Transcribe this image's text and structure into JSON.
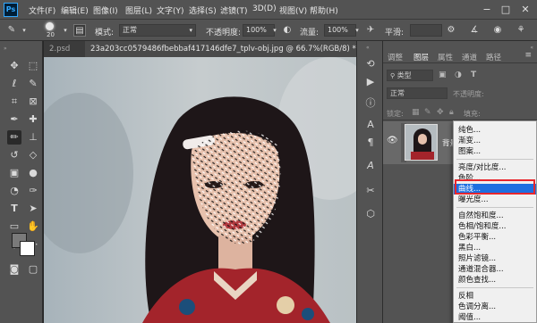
{
  "app": {
    "logo": "Ps"
  },
  "menubar": {
    "items": [
      "文件(F)",
      "编辑(E)",
      "图像(I)",
      "图层(L)",
      "文字(Y)",
      "选择(S)",
      "滤镜(T)",
      "3D(D)",
      "视图(V)",
      "帮助(H)"
    ],
    "window_controls": {
      "minimize": "−",
      "maximize": "□",
      "close": "✕"
    }
  },
  "options_bar": {
    "brush_size": "20",
    "mode_label": "模式:",
    "mode_value": "正常",
    "opacity_label": "不透明度:",
    "opacity_value": "100%",
    "flow_label": "流量:",
    "flow_value": "100%",
    "smooth_label": "平滑:"
  },
  "document_tabs": [
    {
      "label": "2.psd",
      "active": false
    },
    {
      "label": "23a203cc0579486fbebbaf417146dfe7_tplv-obj.jpg @ 66.7%(RGB/8) *",
      "active": true
    }
  ],
  "panel": {
    "tabs": [
      "调整",
      "图层",
      "属性",
      "通道",
      "路径"
    ],
    "active_tab": "图层",
    "filter_label": "类型",
    "blend_mode": "正常",
    "opacity_label": "不透明度:",
    "lock_label": "锁定:",
    "fill_label": "填充:",
    "layer_name": "背景"
  },
  "adjustment_menu": {
    "groups": [
      [
        "纯色...",
        "渐变...",
        "图案..."
      ],
      [
        "亮度/对比度...",
        "色阶...",
        "曲线...",
        "曝光度..."
      ],
      [
        "自然饱和度...",
        "色相/饱和度...",
        "色彩平衡...",
        "黑白...",
        "照片滤镜...",
        "通道混合器...",
        "颜色查找..."
      ],
      [
        "反相",
        "色调分离...",
        "阈值..."
      ]
    ],
    "highlighted": "曲线..."
  },
  "colors": {
    "chrome": "#535353",
    "highlight": "#1e6fe0",
    "callout": "#e8262c",
    "foreground_swatch": "#7a7a7a",
    "background_swatch": "#ffffff"
  }
}
